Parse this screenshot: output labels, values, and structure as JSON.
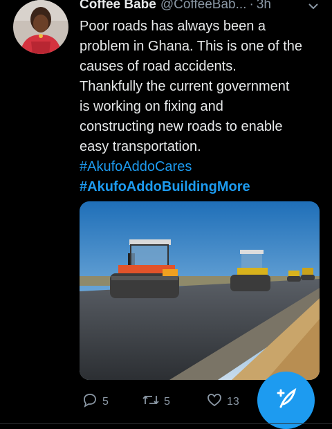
{
  "tweet": {
    "author_name": "Coffee Babe",
    "author_handle": "@CoffeeBab...",
    "separator": "·",
    "time": "3h",
    "text_lines": [
      "Poor roads has always been a",
      "problem in Ghana. This is one of the",
      "causes of road accidents.",
      "Thankfully the current government",
      "is working on fixing  and",
      "constructing new roads to enable",
      "easy transportation."
    ],
    "hashtags": [
      "#AkufoAddoCares",
      "#AkufoAddoBuildingMore"
    ],
    "media_description": "road rollers paving a new road"
  },
  "actions": {
    "reply_count": "5",
    "retweet_count": "5",
    "like_count": "13"
  },
  "colors": {
    "background": "#000000",
    "text": "#e7e9ea",
    "secondary": "#8b98a5",
    "accent": "#1d9bf0"
  },
  "icons": [
    "avatar",
    "chevron-down-icon",
    "reply-icon",
    "retweet-icon",
    "like-icon",
    "compose-icon"
  ]
}
